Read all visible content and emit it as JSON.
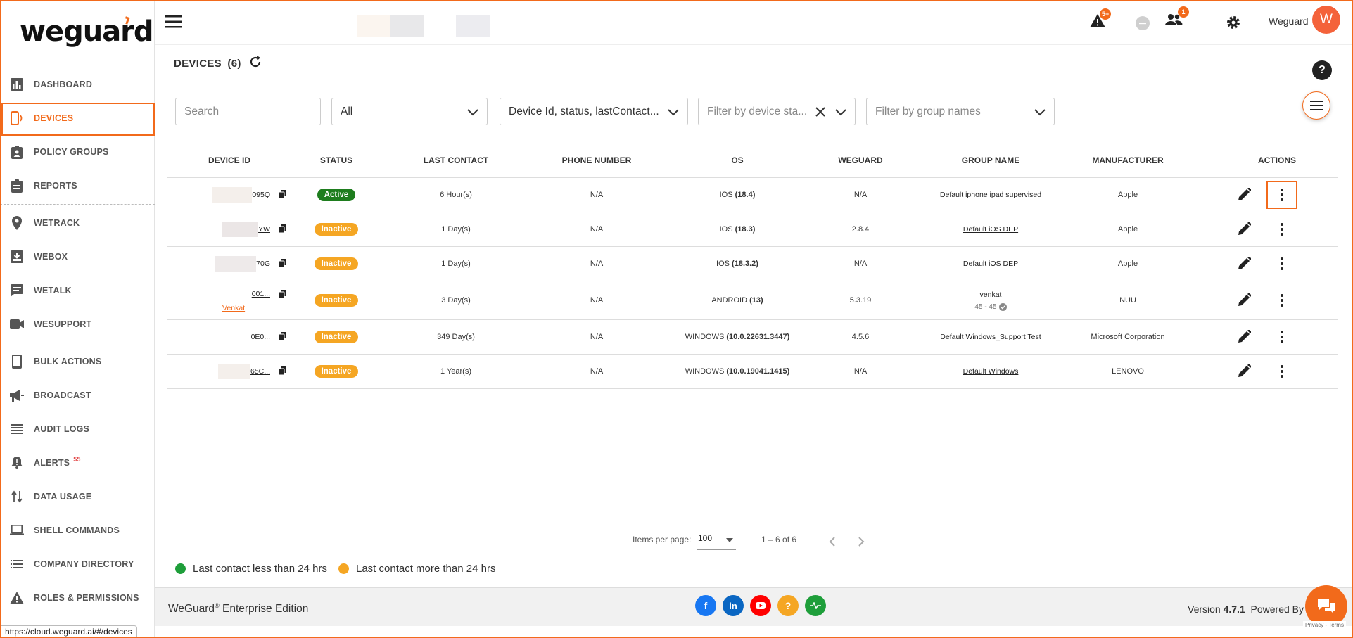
{
  "brand": {
    "logo_text": "weguard",
    "accent": "#f26a1b"
  },
  "sidebar": {
    "items": [
      {
        "label": "DASHBOARD",
        "icon": "bar-chart-icon"
      },
      {
        "label": "DEVICES",
        "icon": "devices-icon",
        "active": true
      },
      {
        "label": "POLICY GROUPS",
        "icon": "clipboard-icon"
      },
      {
        "label": "REPORTS",
        "icon": "report-icon"
      },
      {
        "label": "WETRACK",
        "icon": "location-pin-icon"
      },
      {
        "label": "WEBOX",
        "icon": "inbox-icon"
      },
      {
        "label": "WETALK",
        "icon": "chat-icon"
      },
      {
        "label": "WESUPPORT",
        "icon": "video-icon"
      },
      {
        "label": "BULK ACTIONS",
        "icon": "phone-icon"
      },
      {
        "label": "BROADCAST",
        "icon": "megaphone-icon"
      },
      {
        "label": "AUDIT LOGS",
        "icon": "list-icon"
      },
      {
        "label": "ALERTS",
        "icon": "bell-alert-icon",
        "badge": "55"
      },
      {
        "label": "DATA USAGE",
        "icon": "swap-arrows-icon"
      },
      {
        "label": "SHELL COMMANDS",
        "icon": "laptop-icon"
      },
      {
        "label": "COMPANY DIRECTORY",
        "icon": "directory-list-icon"
      },
      {
        "label": "ROLES & PERMISSIONS",
        "icon": "warning-icon"
      }
    ]
  },
  "topbar": {
    "alert_badge": "5+",
    "users_badge": "1",
    "user_name": "Weguard",
    "avatar_initial": "W"
  },
  "page": {
    "title": "DEVICES",
    "count": "(6)",
    "help": "?"
  },
  "filters": {
    "search_placeholder": "Search",
    "type_value": "All",
    "columns_value": "Device Id, status, lastContact...",
    "status_placeholder": "Filter by device sta...",
    "group_placeholder": "Filter by group names"
  },
  "table": {
    "headers": {
      "device_id": "DEVICE ID",
      "status": "STATUS",
      "last_contact": "LAST CONTACT",
      "phone": "PHONE NUMBER",
      "os": "OS",
      "weguard": "WEGUARD",
      "group": "GROUP NAME",
      "manufacturer": "MANUFACTURER",
      "actions": "ACTIONS"
    },
    "rows": [
      {
        "id": "095Q",
        "status": "Active",
        "last": "6 Hour(s)",
        "phone": "N/A",
        "os": "IOS",
        "os_ver": "(18.4)",
        "weguard": "N/A",
        "group": "Default iphone ipad supervised",
        "man": "Apple"
      },
      {
        "id": "YW",
        "status": "Inactive",
        "last": "1 Day(s)",
        "phone": "N/A",
        "os": "IOS",
        "os_ver": "(18.3)",
        "weguard": "2.8.4",
        "group": "Default iOS DEP",
        "man": "Apple"
      },
      {
        "id": "70G",
        "status": "Inactive",
        "last": "1 Day(s)",
        "phone": "N/A",
        "os": "IOS",
        "os_ver": "(18.3.2)",
        "weguard": "N/A",
        "group": "Default iOS DEP",
        "man": "Apple"
      },
      {
        "id": "001...",
        "user": "Venkat",
        "status": "Inactive",
        "last": "3 Day(s)",
        "phone": "N/A",
        "os": "ANDROID",
        "os_ver": "(13)",
        "weguard": "5.3.19",
        "group": "venkat",
        "group_sub": "45 - 45",
        "man": "NUU"
      },
      {
        "id": "0E0...",
        "status": "Inactive",
        "last": "349 Day(s)",
        "phone": "N/A",
        "os": "WINDOWS",
        "os_ver": "(10.0.22631.3447)",
        "weguard": "4.5.6",
        "group": "Default Windows_Support Test",
        "man": "Microsoft Corporation"
      },
      {
        "id": "65C...",
        "status": "Inactive",
        "last": "1 Year(s)",
        "phone": "N/A",
        "os": "WINDOWS",
        "os_ver": "(10.0.19041.1415)",
        "weguard": "N/A",
        "group": "Default Windows",
        "man": "LENOVO"
      }
    ]
  },
  "pagination": {
    "items_per_page_label": "Items per page:",
    "items_per_page": "100",
    "range": "1 – 6 of 6"
  },
  "legend": {
    "recent": "Last contact less than 24 hrs",
    "old": "Last contact more than 24 hrs",
    "recent_color": "#1e9e3a",
    "old_color": "#f5a623"
  },
  "footer": {
    "edition_prefix": "WeGuard",
    "edition_mark": "®",
    "edition_suffix": " Enterprise Edition",
    "version_label": "Version ",
    "version": "4.7.1",
    "powered": "  Powered By",
    "privacy": "Privacy - Terms"
  },
  "status_url": "https://cloud.weguard.ai/#/devices"
}
